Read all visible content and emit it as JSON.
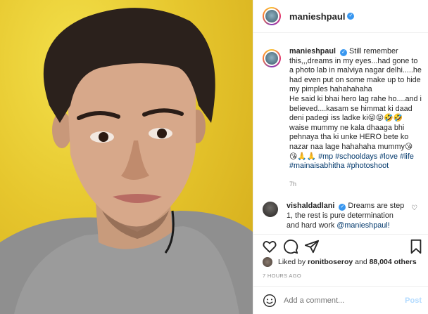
{
  "post": {
    "username": "manieshpaul",
    "verified_icon": "verified-badge-icon"
  },
  "caption": {
    "username": "manieshpaul",
    "text_1": "Still remember this,,,dreams in my eyes...had gone to a photo lab in malviya nagar delhi.....he had even put on some make up to hide my pimples hahahahaha",
    "text_2": "He said ki bhai hero lag rahe ho....and i believed....kasam se himmat ki daad deni padegi iss ladke ki",
    "emojis_1": "😜😝🤣🤣",
    "text_3": "waise mummy ne kala dhaaga bhi pehnaya tha ki unke HERO bete ko nazar naa lage hahahaha mummy",
    "emojis_2": "😘",
    "emojis_3": "😘🙏🙏",
    "hashtags": [
      "#mp",
      "#schooldays",
      "#love",
      "#life",
      "#mainaisabhitha",
      "#photoshoot"
    ],
    "time": "7h"
  },
  "comment": {
    "username": "vishaldadlani",
    "text": "Dreams are step 1, the rest is pure determination and hard work",
    "mention": "@manieshpaul!"
  },
  "likes": {
    "prefix": "Liked by",
    "liker": "ronitboseroy",
    "conjunction": "and",
    "others": "88,004 others"
  },
  "posted_ago": "7 HOURS AGO",
  "add_comment": {
    "placeholder": "Add a comment...",
    "post_label": "Post"
  },
  "colors": {
    "link": "#00376b",
    "verified": "#3897f0",
    "muted": "#8e8e8e",
    "post_disabled": "#b3dbff",
    "photo_background": "#e6c62d"
  }
}
